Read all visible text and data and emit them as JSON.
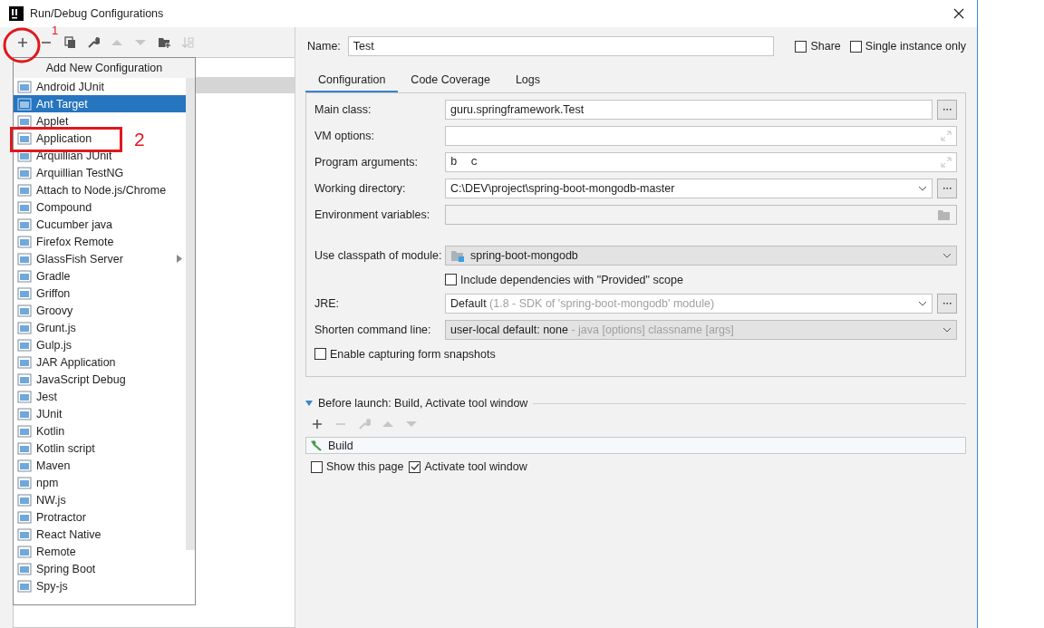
{
  "window": {
    "title": "Run/Debug Configurations"
  },
  "toolbar": [
    {
      "kind": "add",
      "disabled": false
    },
    {
      "kind": "remove",
      "disabled": false
    },
    {
      "kind": "copy",
      "disabled": false
    },
    {
      "kind": "edit",
      "disabled": false
    },
    {
      "kind": "up",
      "disabled": true
    },
    {
      "kind": "down",
      "disabled": true
    },
    {
      "kind": "folder",
      "disabled": false
    },
    {
      "kind": "sort",
      "disabled": true
    }
  ],
  "popup": {
    "title": "Add New Configuration",
    "items": [
      {
        "label": "Android JUnit",
        "selected": false
      },
      {
        "label": "Ant Target",
        "selected": true
      },
      {
        "label": "Applet",
        "selected": false
      },
      {
        "label": "Application",
        "selected": false
      },
      {
        "label": "Arquillian JUnit",
        "selected": false
      },
      {
        "label": "Arquillian TestNG",
        "selected": false
      },
      {
        "label": "Attach to Node.js/Chrome",
        "selected": false
      },
      {
        "label": "Compound",
        "selected": false
      },
      {
        "label": "Cucumber java",
        "selected": false
      },
      {
        "label": "Firefox Remote",
        "selected": false
      },
      {
        "label": "GlassFish Server",
        "selected": false,
        "submenu": true
      },
      {
        "label": "Gradle",
        "selected": false
      },
      {
        "label": "Griffon",
        "selected": false
      },
      {
        "label": "Groovy",
        "selected": false
      },
      {
        "label": "Grunt.js",
        "selected": false
      },
      {
        "label": "Gulp.js",
        "selected": false
      },
      {
        "label": "JAR Application",
        "selected": false
      },
      {
        "label": "JavaScript Debug",
        "selected": false
      },
      {
        "label": "Jest",
        "selected": false
      },
      {
        "label": "JUnit",
        "selected": false
      },
      {
        "label": "Kotlin",
        "selected": false
      },
      {
        "label": "Kotlin script",
        "selected": false
      },
      {
        "label": "Maven",
        "selected": false
      },
      {
        "label": "npm",
        "selected": false
      },
      {
        "label": "NW.js",
        "selected": false
      },
      {
        "label": "Protractor",
        "selected": false
      },
      {
        "label": "React Native",
        "selected": false
      },
      {
        "label": "Remote",
        "selected": false
      },
      {
        "label": "Spring Boot",
        "selected": false
      },
      {
        "label": "Spy-js",
        "selected": false
      }
    ]
  },
  "annotations": [
    {
      "label": "1"
    },
    {
      "label": "2"
    }
  ],
  "name": {
    "label": "Name:",
    "value": "Test"
  },
  "options": [
    {
      "label": "Share",
      "checked": false
    },
    {
      "label": "Single instance only",
      "checked": false
    }
  ],
  "tabs": [
    {
      "label": "Configuration",
      "selected": true
    },
    {
      "label": "Code Coverage",
      "selected": false
    },
    {
      "label": "Logs",
      "selected": false
    }
  ],
  "fields": [
    {
      "kind": "text",
      "label": "Main class:",
      "value": "guru.springframework.Test",
      "browse": true
    },
    {
      "kind": "expand",
      "label": "VM options:"
    },
    {
      "kind": "expand",
      "label": "Program arguments:",
      "value": "b  c"
    },
    {
      "kind": "combo",
      "label": "Working directory:",
      "value": "C:\\DEV\\project\\spring-boot-mongodb-master",
      "browse": true
    },
    {
      "kind": "folder",
      "label": "Environment variables:"
    }
  ],
  "module_fields": [
    {
      "kind": "module",
      "label": "Use classpath of module:",
      "value": "spring-boot-mongodb"
    },
    {
      "kind": "field-checkbox",
      "label": "Include dependencies with \"Provided\" scope",
      "checked": false
    },
    {
      "kind": "combo",
      "label": "JRE:",
      "value": "Default",
      "hint": "(1.8 - SDK of 'spring-boot-mongodb' module)",
      "browse": true
    },
    {
      "kind": "select",
      "label": "Shorten command line:",
      "value": "user-local default: none",
      "hint": "- java [options] classname [args]"
    },
    {
      "kind": "checkbox",
      "label": "Enable capturing form snapshots",
      "checked": false
    }
  ],
  "before_launch": {
    "title": "Before launch: Build, Activate tool window",
    "expanded": true,
    "toolbar": [
      {
        "kind": "add",
        "disabled": false
      },
      {
        "kind": "remove",
        "disabled": true
      },
      {
        "kind": "edit",
        "disabled": true
      },
      {
        "kind": "up",
        "disabled": true
      },
      {
        "kind": "down",
        "disabled": true
      }
    ],
    "tasks": [
      {
        "label": "Build"
      }
    ],
    "options": [
      {
        "label": "Show this page",
        "checked": false
      },
      {
        "label": "Activate tool window",
        "checked": true
      }
    ]
  }
}
